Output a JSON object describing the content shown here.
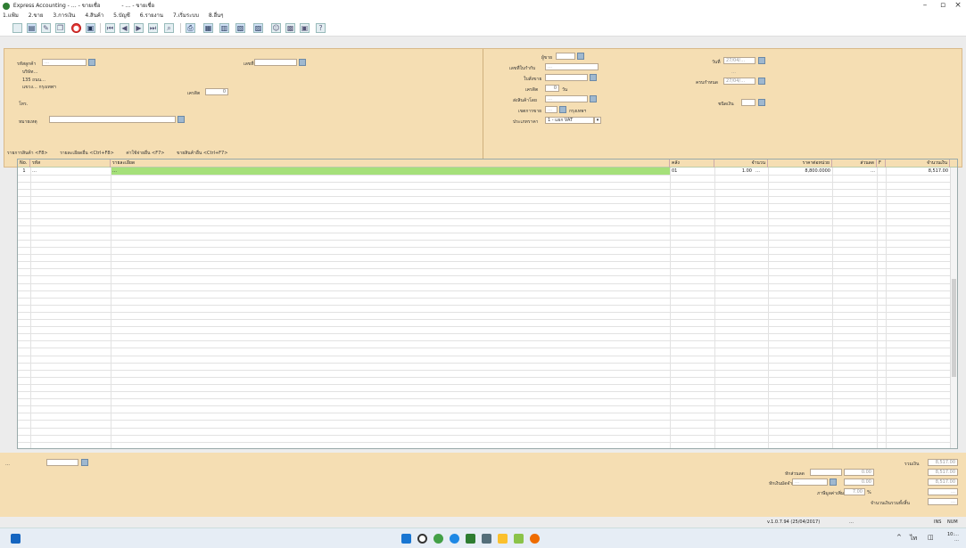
{
  "window": {
    "title": "Express Accounting - … - ขายเชื่อ",
    "subtitle": "- … - ขายเชื่อ"
  },
  "menu": [
    "1.แฟ้ม",
    "2.ขาย",
    "3.การเงิน",
    "4.สินค้า",
    "5.บัญชี",
    "6.รายงาน",
    "7.เริ่มระบบ",
    "8.อื่นๆ"
  ],
  "toolbar_icons": [
    "new-icon",
    "open-icon",
    "edit-icon",
    "copy-icon",
    "cancel-icon",
    "save-icon",
    "first-icon",
    "prev-icon",
    "next-icon",
    "last-icon",
    "find-icon",
    "print-icon",
    "preview-icon",
    "export-icon",
    "report-icon",
    "refresh-icon",
    "user-icon",
    "chart-icon",
    "calc-icon",
    "help-icon"
  ],
  "form": {
    "customer_code_label": "รหัสลูกค้า",
    "customer_code": "…",
    "customer_name": "บริษัท…",
    "address_line1": "135 ถนน…",
    "address_line2": "แขวง… กรุงเทพฯ",
    "dept_label": "ผู้ขาย",
    "credit_label": "เครดิต",
    "credit_value": "0",
    "tel_label": "โทร.",
    "remark_label": "หมายเหตุ",
    "ref_label": "เลขที่",
    "doc_no_label": "เลขที่ใบกำกับ",
    "doc_no": "…",
    "salesman_label": "ใบสั่งขาย",
    "credit_days_label": "เครดิต",
    "credit_days": "0",
    "days_unit": "วัน",
    "deliver_label": "ส่งสินค้าโดย",
    "deliver_value": "…",
    "ar_label": "เขตการขาย",
    "ar_value": "…",
    "ar_name": "กรุงเทพฯ",
    "vat_type_label": "ประเภทราคา",
    "vat_type": "1 - แยก VAT",
    "date_label": "วันที่",
    "date_value": "27/04/…",
    "due_note": "…",
    "due_date_label": "ครบกำหนด",
    "due_date": "27/04/…",
    "cash_label": "ชนิดเงิน"
  },
  "tabs": [
    "รายการสินค้า <F8>",
    "รายละเอียดอื่น <Ctrl+F8>",
    "ค่าใช้จ่ายอื่น <F7>",
    "ขายสินค้าอื่น <Ctrl+F7>"
  ],
  "table": {
    "headers": [
      "No.",
      "รหัส",
      "รายละเอียด",
      "คลัง",
      "จำนวน",
      "ราคาต่อหน่วย",
      "ส่วนลด",
      "F",
      "จำนวนเงิน"
    ],
    "rows": [
      {
        "no": "1",
        "code": "…",
        "desc": "…",
        "wh": "01",
        "qty": "1.00",
        "unit": "…",
        "price": "8,800.0000",
        "discount": "…",
        "flag": "",
        "amount": "8,517.00"
      }
    ]
  },
  "bottom": {
    "remark_label": "…",
    "subtotal_label": "รวมเงิน",
    "subtotal": "8,517.00",
    "discount_label": "หักส่วนลด",
    "discount": "0.00",
    "deposit_label": "หักเงินมัดจำ",
    "deposit_code": "…",
    "deposit": "0.00",
    "net_label": "…",
    "net": "8,517.00",
    "vat_label": "ภาษีมูลค่าเพิ่ม",
    "vat_rate": "7.00",
    "vat_unit": "%",
    "vat": "…",
    "total_label": "จำนวนเงินรวมทั้งสิ้น",
    "total": "…"
  },
  "status": {
    "version": "v.1.0.7.94 (25/04/2017)",
    "user": "…",
    "ins": "INS",
    "num": "NUM"
  },
  "taskbar": {
    "time": "10:…",
    "date": "…"
  }
}
